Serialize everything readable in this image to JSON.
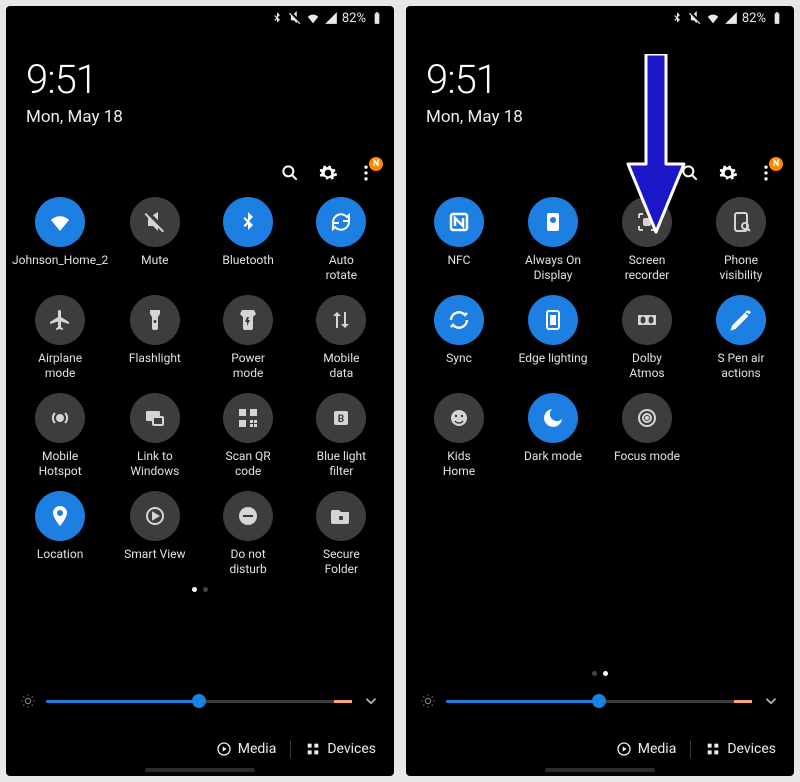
{
  "status": {
    "battery_percent": "82%"
  },
  "clock": {
    "time": "9:51",
    "date": "Mon, May 18"
  },
  "toolbar": {
    "badge": "N"
  },
  "brightness": {
    "percent": 50
  },
  "bottom": {
    "media": "Media",
    "devices": "Devices"
  },
  "page1": {
    "tiles": [
      {
        "label": "Johnson_Home_2",
        "active": true,
        "icon": "wifi"
      },
      {
        "label": "Mute",
        "active": false,
        "icon": "mute"
      },
      {
        "label": "Bluetooth",
        "active": true,
        "icon": "bluetooth"
      },
      {
        "label": "Auto\nrotate",
        "active": true,
        "icon": "autorotate"
      },
      {
        "label": "Airplane\nmode",
        "active": false,
        "icon": "airplane"
      },
      {
        "label": "Flashlight",
        "active": false,
        "icon": "flashlight"
      },
      {
        "label": "Power\nmode",
        "active": false,
        "icon": "power"
      },
      {
        "label": "Mobile\ndata",
        "active": false,
        "icon": "mobiledata"
      },
      {
        "label": "Mobile\nHotspot",
        "active": false,
        "icon": "hotspot"
      },
      {
        "label": "Link to\nWindows",
        "active": false,
        "icon": "linkwindows"
      },
      {
        "label": "Scan QR\ncode",
        "active": false,
        "icon": "qr"
      },
      {
        "label": "Blue light\nfilter",
        "active": false,
        "icon": "bluelight"
      },
      {
        "label": "Location",
        "active": true,
        "icon": "location"
      },
      {
        "label": "Smart View",
        "active": false,
        "icon": "smartview"
      },
      {
        "label": "Do not\ndisturb",
        "active": false,
        "icon": "dnd"
      },
      {
        "label": "Secure\nFolder",
        "active": false,
        "icon": "securefolder"
      }
    ],
    "page_active": 0
  },
  "page2": {
    "tiles": [
      {
        "label": "NFC",
        "active": true,
        "icon": "nfc"
      },
      {
        "label": "Always On\nDisplay",
        "active": true,
        "icon": "aod"
      },
      {
        "label": "Screen\nrecorder",
        "active": false,
        "icon": "screenrec"
      },
      {
        "label": "Phone\nvisibility",
        "active": false,
        "icon": "phonevis"
      },
      {
        "label": "Sync",
        "active": true,
        "icon": "sync"
      },
      {
        "label": "Edge lighting",
        "active": true,
        "icon": "edgelight"
      },
      {
        "label": "Dolby\nAtmos",
        "active": false,
        "icon": "dolby"
      },
      {
        "label": "S Pen air\nactions",
        "active": true,
        "icon": "spen"
      },
      {
        "label": "Kids\nHome",
        "active": false,
        "icon": "kids"
      },
      {
        "label": "Dark mode",
        "active": true,
        "icon": "darkmode"
      },
      {
        "label": "Focus mode",
        "active": false,
        "icon": "focus"
      }
    ],
    "page_active": 1
  },
  "annotation": {
    "arrow_color": "#1b17c9"
  }
}
